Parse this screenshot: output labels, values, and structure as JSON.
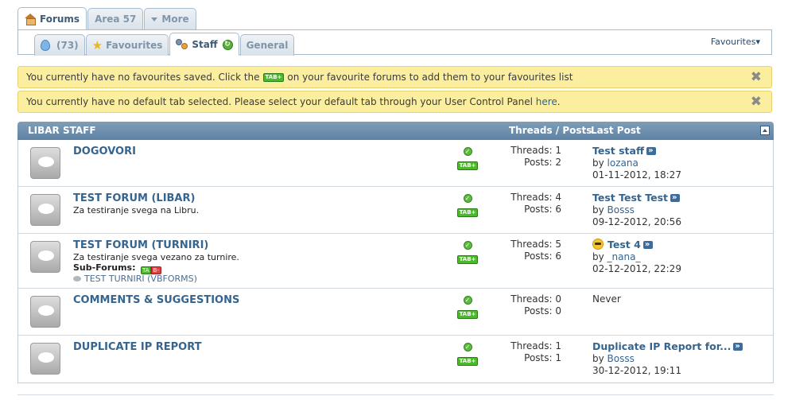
{
  "top_tabs": [
    {
      "label": "Forums",
      "active": true,
      "icon": "home-icon"
    },
    {
      "label": "Area 57",
      "active": false
    },
    {
      "label": "More",
      "active": false,
      "icon": "chevron-down-icon"
    }
  ],
  "sub_tabs": {
    "count_label": "(73)",
    "favourites": "Favourites",
    "staff": "Staff",
    "general": "General"
  },
  "favourites_dropdown": "Favourites▾",
  "notices": {
    "favourites_pre": "You currently have no favourites saved. Click the",
    "tab_badge": "TAB+",
    "favourites_post": "on your favourite forums to add them to your favourites list",
    "default_tab_pre": "You currently have no default tab selected. Please select your default tab through your User Control Panel",
    "default_tab_link": "here",
    "default_tab_post": "."
  },
  "forum_header": {
    "title": "LIBAR STAFF",
    "threads_posts": "Threads / Posts",
    "last_post": "Last Post"
  },
  "forums": [
    {
      "name": "DOGOVORI",
      "description": "",
      "tab_badge": "TAB+",
      "threads": "Threads: 1",
      "posts": "Posts: 2",
      "last_title": "Test staff",
      "last_by_prefix": "by",
      "last_by": "lozana",
      "last_date": "01-11-2012, 18:27"
    },
    {
      "name": "TEST FORUM (LIBAR)",
      "description": "Za testiranje svega na Libru.",
      "tab_badge": "TAB+",
      "threads": "Threads: 4",
      "posts": "Posts: 6",
      "last_title": "Test Test Test",
      "last_by_prefix": "by",
      "last_by": "Bosss",
      "last_date": "09-12-2012, 20:56"
    },
    {
      "name": "TEST FORUM (TURNIRI)",
      "description": "Za testiranje svega vezano za turnire.",
      "sub_forums_label": "Sub-Forums:",
      "sub_forum": "TEST TURNIRI (VBFORMS)",
      "tab_badge": "TAB+",
      "threads": "Threads: 5",
      "posts": "Posts: 6",
      "last_title": "Test 4",
      "last_by_prefix": "by",
      "last_by": "_nana_",
      "last_date": "02-12-2012, 22:29"
    },
    {
      "name": "COMMENTS & SUGGESTIONS",
      "description": "",
      "tab_badge": "TAB+",
      "threads": "Threads: 0",
      "posts": "Posts: 0",
      "last_never": "Never"
    },
    {
      "name": "DUPLICATE IP REPORT",
      "description": "",
      "tab_badge": "TAB+",
      "threads": "Threads: 1",
      "posts": "Posts: 1",
      "last_title": "Duplicate IP Report for...",
      "last_by_prefix": "by",
      "last_by": "Bosss",
      "last_date": "30-12-2012, 19:11"
    }
  ]
}
